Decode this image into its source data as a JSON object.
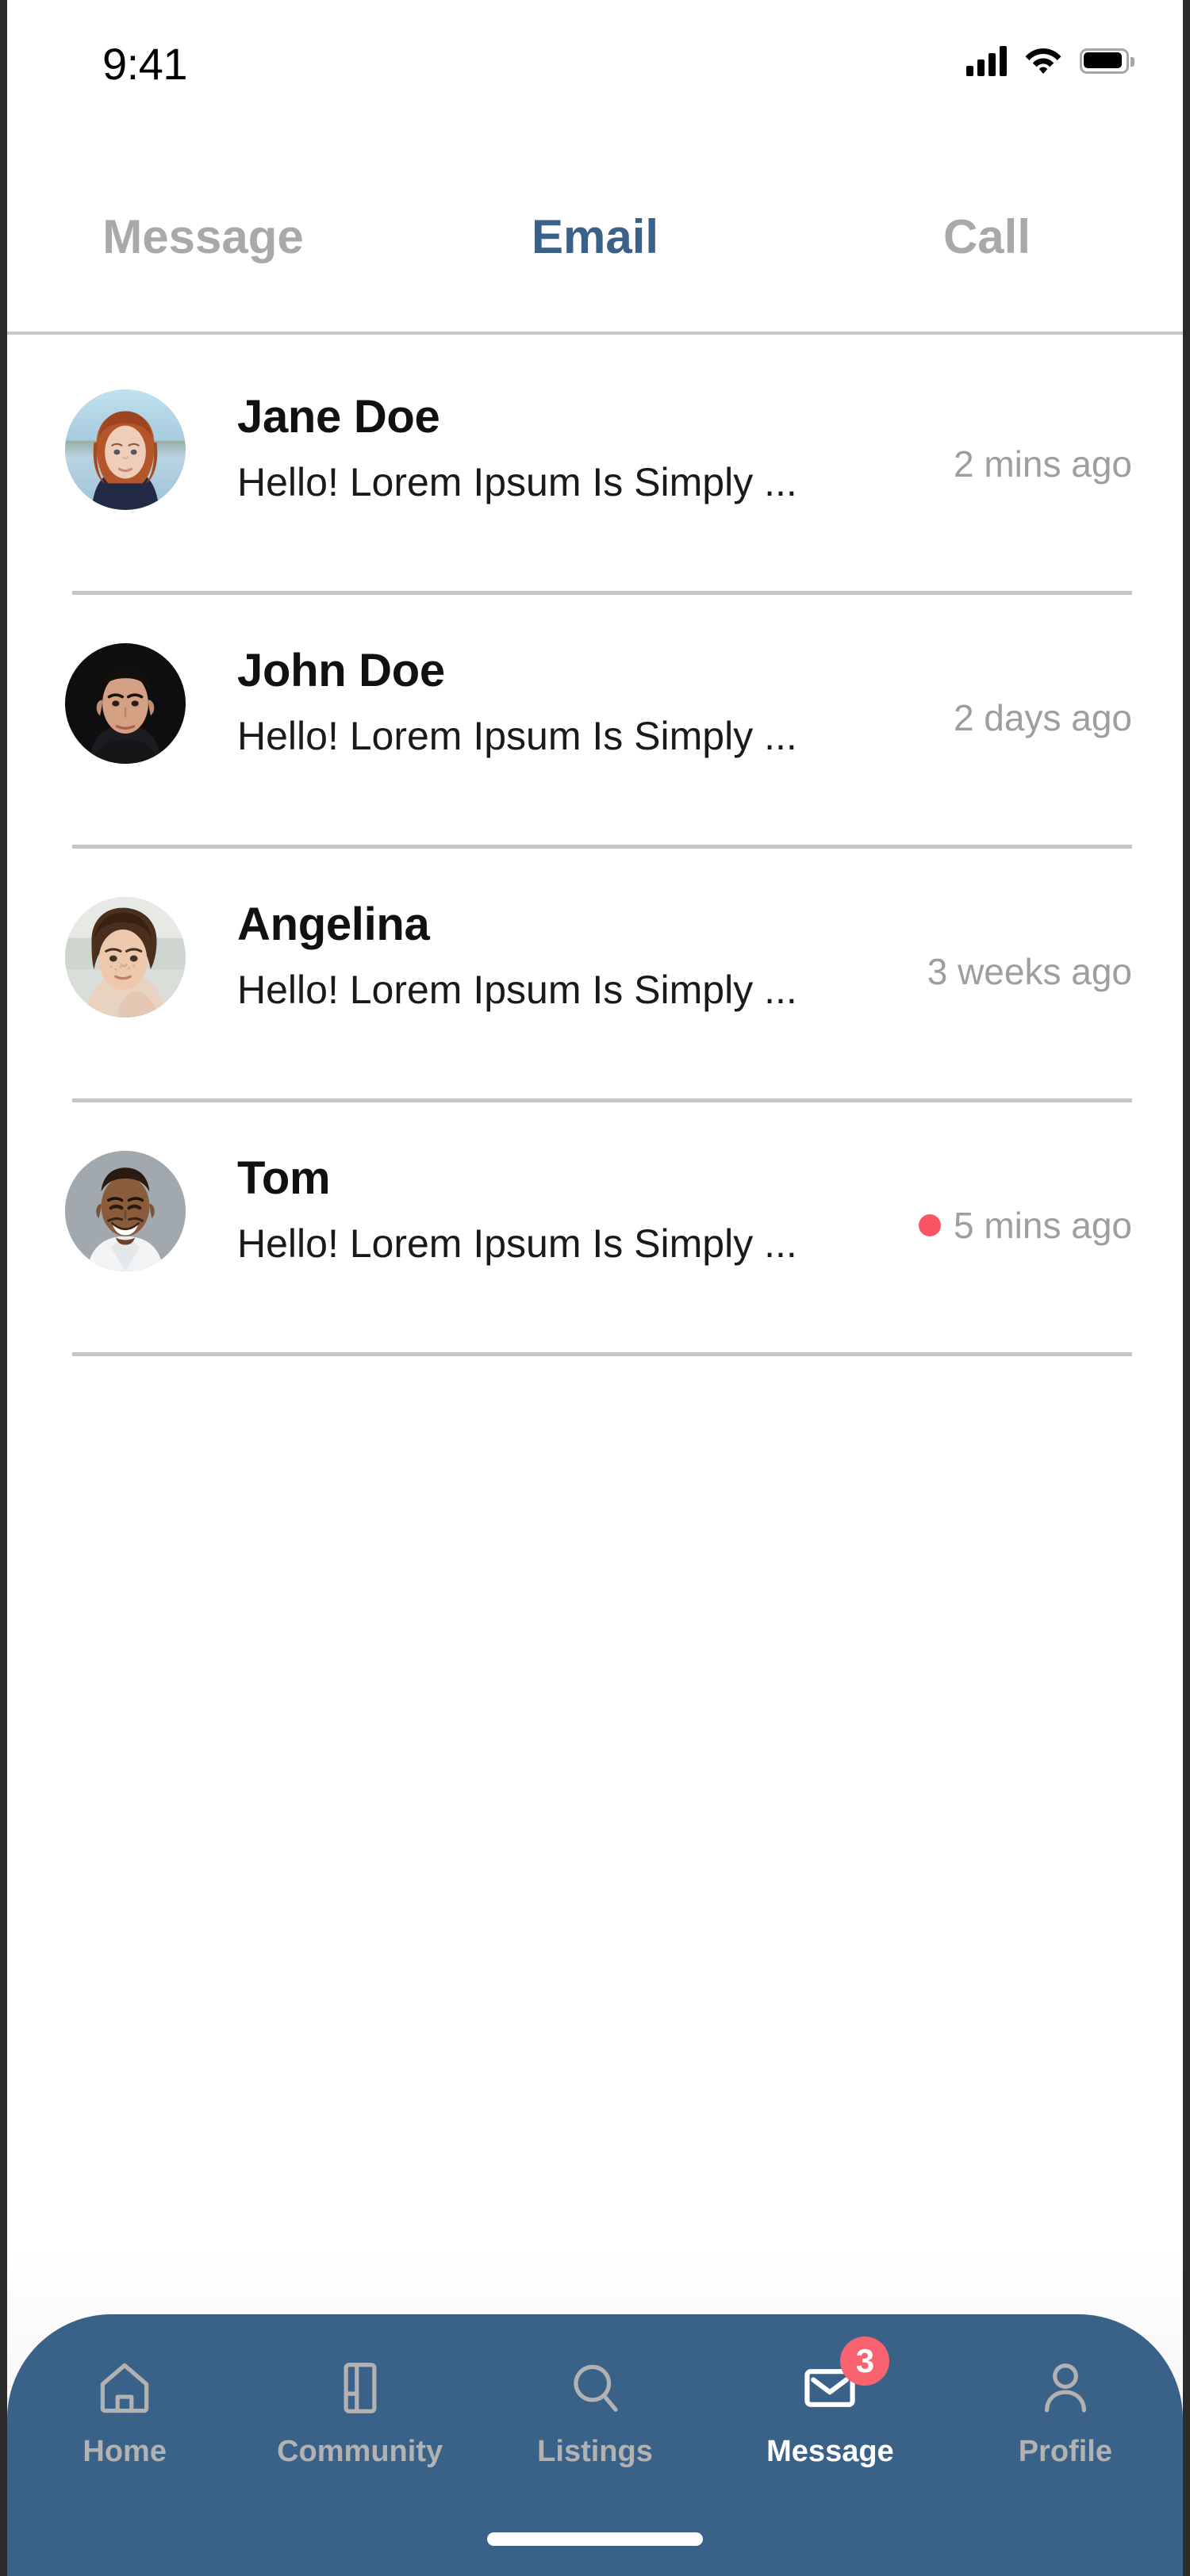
{
  "status_bar": {
    "time": "9:41",
    "icons": [
      "cellular-signal-icon",
      "wifi-icon",
      "battery-icon"
    ],
    "battery_full": true,
    "signal_bars": 4
  },
  "top_tabs": {
    "active_index": 1,
    "items": [
      {
        "label": "Message"
      },
      {
        "label": "Email"
      },
      {
        "label": "Call"
      }
    ]
  },
  "conversations": [
    {
      "name": "Jane Doe",
      "preview": "Hello! Lorem Ipsum Is Simply ...",
      "time": "2 mins ago",
      "unread": false,
      "avatar": "avatar-jane-doe"
    },
    {
      "name": "John Doe",
      "preview": "Hello! Lorem Ipsum Is Simply ...",
      "time": "2 days ago",
      "unread": false,
      "avatar": "avatar-john-doe"
    },
    {
      "name": "Angelina",
      "preview": "Hello! Lorem Ipsum Is Simply ...",
      "time": "3 weeks ago",
      "unread": false,
      "avatar": "avatar-angelina"
    },
    {
      "name": "Tom",
      "preview": "Hello! Lorem Ipsum Is Simply ...",
      "time": "5 mins ago",
      "unread": true,
      "avatar": "avatar-tom"
    }
  ],
  "bottom_nav": {
    "active_index": 3,
    "items": [
      {
        "label": "Home",
        "icon": "home-icon"
      },
      {
        "label": "Community",
        "icon": "book-icon"
      },
      {
        "label": "Listings",
        "icon": "search-icon"
      },
      {
        "label": "Message",
        "icon": "envelope-icon",
        "badge": "3"
      },
      {
        "label": "Profile",
        "icon": "person-icon"
      }
    ]
  },
  "colors": {
    "accent_blue": "#3a6289",
    "unread_red": "#fb5563",
    "badge_red": "#f9626f",
    "muted_gray": "#9e9e9e",
    "tab_inactive": "#a9a9a9",
    "nav_label_inactive": "#b2b2b2",
    "separator": "#c6c6c6"
  }
}
